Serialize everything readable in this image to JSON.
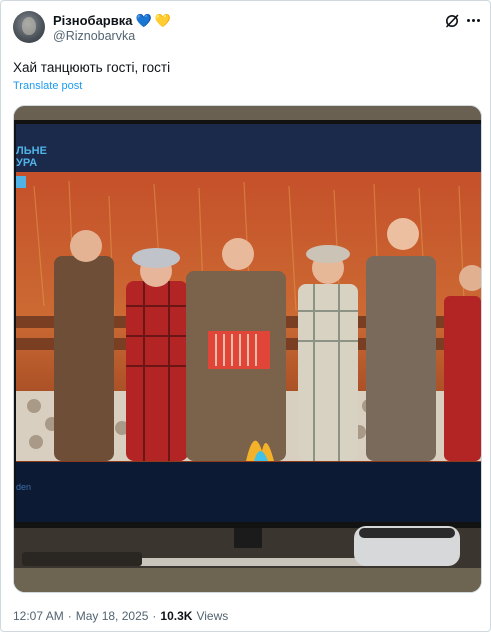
{
  "author": {
    "display_name": "Різнобарвка",
    "badges": [
      "💙",
      "💛"
    ],
    "handle": "@Riznobarvka"
  },
  "header_icons": {
    "grok": "grok-icon",
    "more": "more-dots-icon"
  },
  "tweet": {
    "text": "Хай танцюють гості, гості",
    "translate_label": "Translate post"
  },
  "media": {
    "tv_overlay_line1": "ЛЬНЕ",
    "tv_overlay_line2": "УРА",
    "tv_bottom_text": "den"
  },
  "meta": {
    "time": "12:07 AM",
    "separator": "·",
    "date": "May 18, 2025",
    "views_count": "10.3K",
    "views_label": "Views"
  }
}
